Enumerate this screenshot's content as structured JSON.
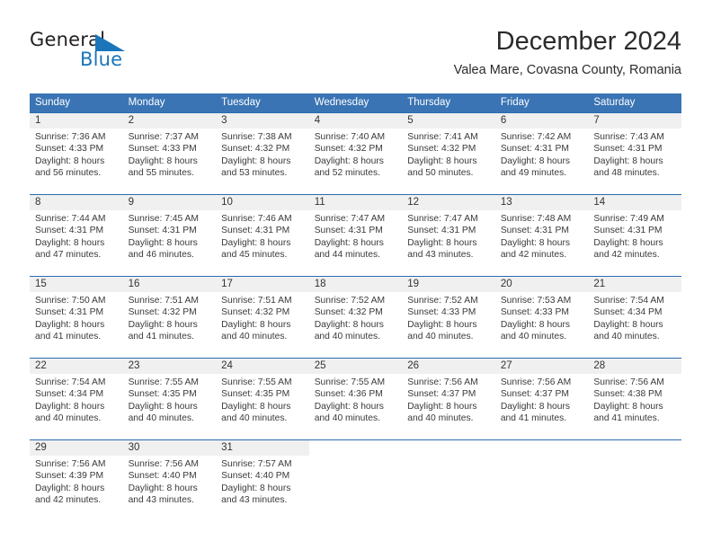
{
  "brand": {
    "name_part1": "General",
    "name_part2": "Blue",
    "logo_icon": "triangle-flag-icon",
    "accent_color": "#1b75bb"
  },
  "header": {
    "title": "December 2024",
    "subtitle": "Valea Mare, Covasna County, Romania"
  },
  "calendar": {
    "header_bg": "#3a74b4",
    "grid_line_color": "#2b6cb0",
    "daynum_band_color": "#f0f0f0",
    "weekday_headers": [
      "Sunday",
      "Monday",
      "Tuesday",
      "Wednesday",
      "Thursday",
      "Friday",
      "Saturday"
    ],
    "weeks": [
      [
        {
          "day": "1",
          "sunrise": "Sunrise: 7:36 AM",
          "sunset": "Sunset: 4:33 PM",
          "daylight_line1": "Daylight: 8 hours",
          "daylight_line2": "and 56 minutes."
        },
        {
          "day": "2",
          "sunrise": "Sunrise: 7:37 AM",
          "sunset": "Sunset: 4:33 PM",
          "daylight_line1": "Daylight: 8 hours",
          "daylight_line2": "and 55 minutes."
        },
        {
          "day": "3",
          "sunrise": "Sunrise: 7:38 AM",
          "sunset": "Sunset: 4:32 PM",
          "daylight_line1": "Daylight: 8 hours",
          "daylight_line2": "and 53 minutes."
        },
        {
          "day": "4",
          "sunrise": "Sunrise: 7:40 AM",
          "sunset": "Sunset: 4:32 PM",
          "daylight_line1": "Daylight: 8 hours",
          "daylight_line2": "and 52 minutes."
        },
        {
          "day": "5",
          "sunrise": "Sunrise: 7:41 AM",
          "sunset": "Sunset: 4:32 PM",
          "daylight_line1": "Daylight: 8 hours",
          "daylight_line2": "and 50 minutes."
        },
        {
          "day": "6",
          "sunrise": "Sunrise: 7:42 AM",
          "sunset": "Sunset: 4:31 PM",
          "daylight_line1": "Daylight: 8 hours",
          "daylight_line2": "and 49 minutes."
        },
        {
          "day": "7",
          "sunrise": "Sunrise: 7:43 AM",
          "sunset": "Sunset: 4:31 PM",
          "daylight_line1": "Daylight: 8 hours",
          "daylight_line2": "and 48 minutes."
        }
      ],
      [
        {
          "day": "8",
          "sunrise": "Sunrise: 7:44 AM",
          "sunset": "Sunset: 4:31 PM",
          "daylight_line1": "Daylight: 8 hours",
          "daylight_line2": "and 47 minutes."
        },
        {
          "day": "9",
          "sunrise": "Sunrise: 7:45 AM",
          "sunset": "Sunset: 4:31 PM",
          "daylight_line1": "Daylight: 8 hours",
          "daylight_line2": "and 46 minutes."
        },
        {
          "day": "10",
          "sunrise": "Sunrise: 7:46 AM",
          "sunset": "Sunset: 4:31 PM",
          "daylight_line1": "Daylight: 8 hours",
          "daylight_line2": "and 45 minutes."
        },
        {
          "day": "11",
          "sunrise": "Sunrise: 7:47 AM",
          "sunset": "Sunset: 4:31 PM",
          "daylight_line1": "Daylight: 8 hours",
          "daylight_line2": "and 44 minutes."
        },
        {
          "day": "12",
          "sunrise": "Sunrise: 7:47 AM",
          "sunset": "Sunset: 4:31 PM",
          "daylight_line1": "Daylight: 8 hours",
          "daylight_line2": "and 43 minutes."
        },
        {
          "day": "13",
          "sunrise": "Sunrise: 7:48 AM",
          "sunset": "Sunset: 4:31 PM",
          "daylight_line1": "Daylight: 8 hours",
          "daylight_line2": "and 42 minutes."
        },
        {
          "day": "14",
          "sunrise": "Sunrise: 7:49 AM",
          "sunset": "Sunset: 4:31 PM",
          "daylight_line1": "Daylight: 8 hours",
          "daylight_line2": "and 42 minutes."
        }
      ],
      [
        {
          "day": "15",
          "sunrise": "Sunrise: 7:50 AM",
          "sunset": "Sunset: 4:31 PM",
          "daylight_line1": "Daylight: 8 hours",
          "daylight_line2": "and 41 minutes."
        },
        {
          "day": "16",
          "sunrise": "Sunrise: 7:51 AM",
          "sunset": "Sunset: 4:32 PM",
          "daylight_line1": "Daylight: 8 hours",
          "daylight_line2": "and 41 minutes."
        },
        {
          "day": "17",
          "sunrise": "Sunrise: 7:51 AM",
          "sunset": "Sunset: 4:32 PM",
          "daylight_line1": "Daylight: 8 hours",
          "daylight_line2": "and 40 minutes."
        },
        {
          "day": "18",
          "sunrise": "Sunrise: 7:52 AM",
          "sunset": "Sunset: 4:32 PM",
          "daylight_line1": "Daylight: 8 hours",
          "daylight_line2": "and 40 minutes."
        },
        {
          "day": "19",
          "sunrise": "Sunrise: 7:52 AM",
          "sunset": "Sunset: 4:33 PM",
          "daylight_line1": "Daylight: 8 hours",
          "daylight_line2": "and 40 minutes."
        },
        {
          "day": "20",
          "sunrise": "Sunrise: 7:53 AM",
          "sunset": "Sunset: 4:33 PM",
          "daylight_line1": "Daylight: 8 hours",
          "daylight_line2": "and 40 minutes."
        },
        {
          "day": "21",
          "sunrise": "Sunrise: 7:54 AM",
          "sunset": "Sunset: 4:34 PM",
          "daylight_line1": "Daylight: 8 hours",
          "daylight_line2": "and 40 minutes."
        }
      ],
      [
        {
          "day": "22",
          "sunrise": "Sunrise: 7:54 AM",
          "sunset": "Sunset: 4:34 PM",
          "daylight_line1": "Daylight: 8 hours",
          "daylight_line2": "and 40 minutes."
        },
        {
          "day": "23",
          "sunrise": "Sunrise: 7:55 AM",
          "sunset": "Sunset: 4:35 PM",
          "daylight_line1": "Daylight: 8 hours",
          "daylight_line2": "and 40 minutes."
        },
        {
          "day": "24",
          "sunrise": "Sunrise: 7:55 AM",
          "sunset": "Sunset: 4:35 PM",
          "daylight_line1": "Daylight: 8 hours",
          "daylight_line2": "and 40 minutes."
        },
        {
          "day": "25",
          "sunrise": "Sunrise: 7:55 AM",
          "sunset": "Sunset: 4:36 PM",
          "daylight_line1": "Daylight: 8 hours",
          "daylight_line2": "and 40 minutes."
        },
        {
          "day": "26",
          "sunrise": "Sunrise: 7:56 AM",
          "sunset": "Sunset: 4:37 PM",
          "daylight_line1": "Daylight: 8 hours",
          "daylight_line2": "and 40 minutes."
        },
        {
          "day": "27",
          "sunrise": "Sunrise: 7:56 AM",
          "sunset": "Sunset: 4:37 PM",
          "daylight_line1": "Daylight: 8 hours",
          "daylight_line2": "and 41 minutes."
        },
        {
          "day": "28",
          "sunrise": "Sunrise: 7:56 AM",
          "sunset": "Sunset: 4:38 PM",
          "daylight_line1": "Daylight: 8 hours",
          "daylight_line2": "and 41 minutes."
        }
      ],
      [
        {
          "day": "29",
          "sunrise": "Sunrise: 7:56 AM",
          "sunset": "Sunset: 4:39 PM",
          "daylight_line1": "Daylight: 8 hours",
          "daylight_line2": "and 42 minutes."
        },
        {
          "day": "30",
          "sunrise": "Sunrise: 7:56 AM",
          "sunset": "Sunset: 4:40 PM",
          "daylight_line1": "Daylight: 8 hours",
          "daylight_line2": "and 43 minutes."
        },
        {
          "day": "31",
          "sunrise": "Sunrise: 7:57 AM",
          "sunset": "Sunset: 4:40 PM",
          "daylight_line1": "Daylight: 8 hours",
          "daylight_line2": "and 43 minutes."
        },
        {
          "day": "",
          "sunrise": "",
          "sunset": "",
          "daylight_line1": "",
          "daylight_line2": ""
        },
        {
          "day": "",
          "sunrise": "",
          "sunset": "",
          "daylight_line1": "",
          "daylight_line2": ""
        },
        {
          "day": "",
          "sunrise": "",
          "sunset": "",
          "daylight_line1": "",
          "daylight_line2": ""
        },
        {
          "day": "",
          "sunrise": "",
          "sunset": "",
          "daylight_line1": "",
          "daylight_line2": ""
        }
      ]
    ]
  }
}
